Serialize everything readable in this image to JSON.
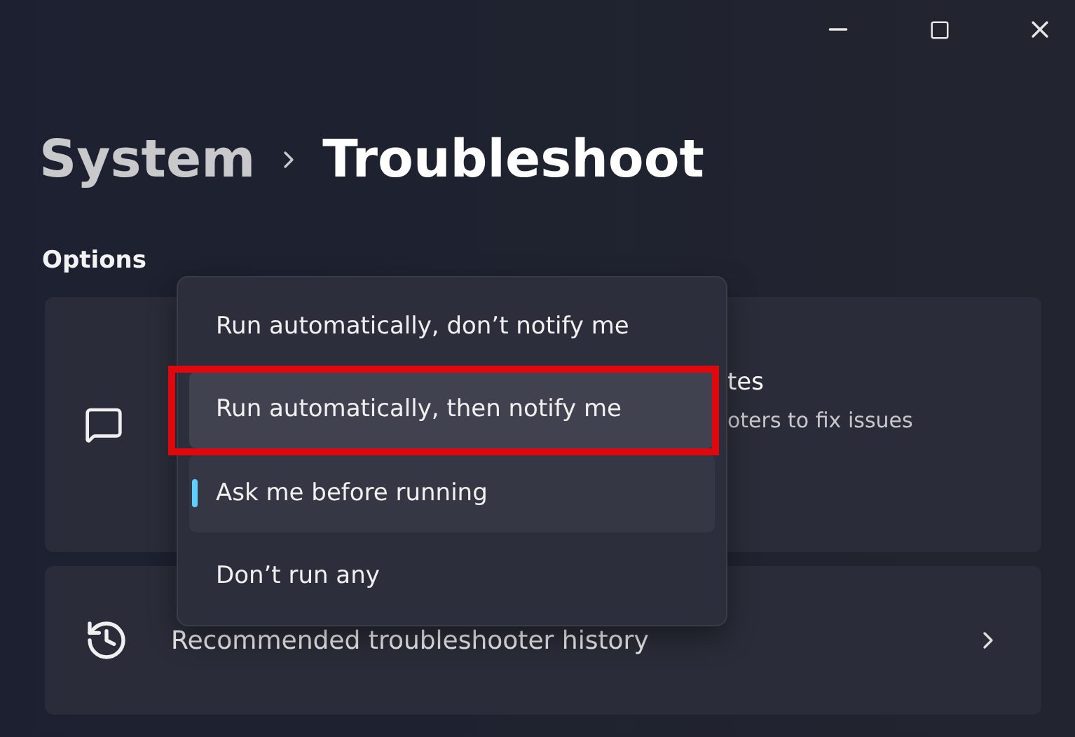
{
  "breadcrumb": {
    "parent": "System",
    "current": "Troubleshoot"
  },
  "section_title": "Options",
  "cards": [
    {
      "kind": "setting",
      "title": "tes",
      "description": "oters to fix issues"
    },
    {
      "kind": "link",
      "title": "Recommended troubleshooter history"
    }
  ],
  "menu": {
    "items": [
      {
        "label": "Run automatically, don’t notify me",
        "selected": false,
        "hovered": false,
        "highlighted": false
      },
      {
        "label": "Run automatically, then notify me",
        "selected": false,
        "hovered": true,
        "highlighted": true
      },
      {
        "label": "Ask me before running",
        "selected": true,
        "hovered": false,
        "highlighted": false
      },
      {
        "label": "Don’t run any",
        "selected": false,
        "hovered": false,
        "highlighted": false
      }
    ]
  }
}
